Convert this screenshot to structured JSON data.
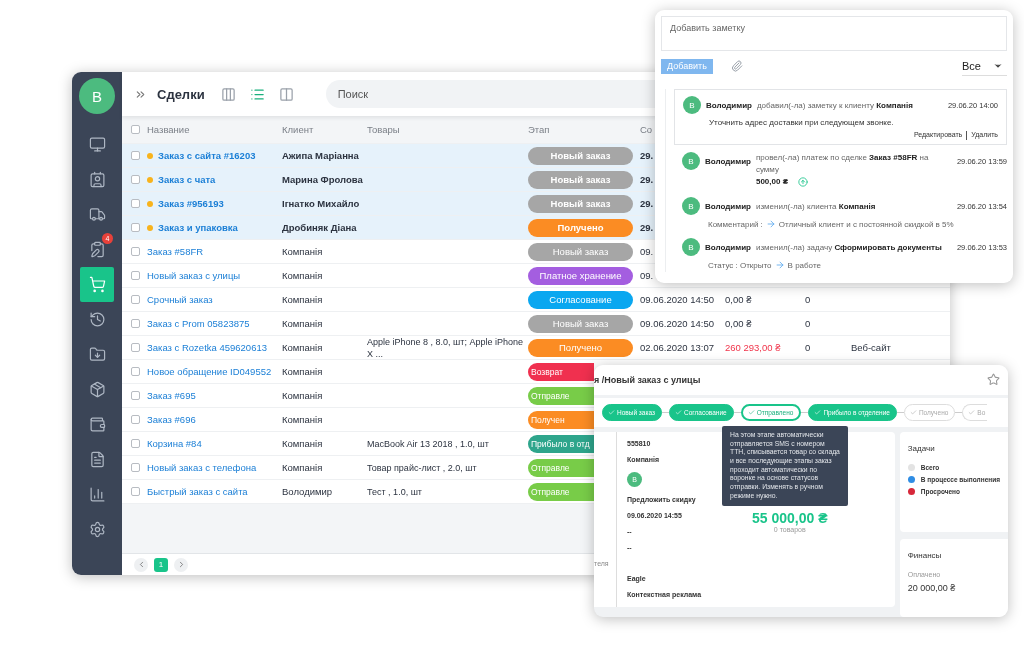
{
  "sidebar": {
    "avatar": "В",
    "items": [
      {
        "selected": false
      },
      {
        "selected": false
      },
      {
        "selected": false
      },
      {
        "selected": false,
        "badge": "4"
      },
      {
        "selected": true
      },
      {
        "selected": false
      },
      {
        "selected": false
      },
      {
        "selected": false
      },
      {
        "selected": false
      },
      {
        "selected": false
      },
      {
        "selected": false
      },
      {
        "selected": false
      }
    ]
  },
  "toolbar": {
    "title": "Сделки",
    "views": [
      {
        "selected": false
      },
      {
        "selected": true
      },
      {
        "selected": false
      }
    ],
    "search": {
      "placeholder": "Поиск"
    }
  },
  "table": {
    "select_all": {
      "checked": false
    },
    "columns": [
      "Название",
      "Клиент",
      "Товары",
      "Этап",
      "Со"
    ],
    "rows": [
      {
        "unread": true,
        "name": "Заказ с сайта #16203",
        "client": "Ажипа Маріанна",
        "stage": "Новый заказ",
        "color": "#a6a6a6",
        "date": "29."
      },
      {
        "unread": true,
        "name": "Заказ с чата",
        "client": "Марина Фролова",
        "stage": "Новый заказ",
        "color": "#a6a6a6",
        "date": "29."
      },
      {
        "unread": true,
        "name": "Заказ #956193",
        "client": "Ігнатко Михайло",
        "stage": "Новый заказ",
        "color": "#a6a6a6",
        "date": "29."
      },
      {
        "unread": true,
        "name": "Заказ и упаковка",
        "client": "Дробиняк Діана",
        "stage": "Получено",
        "color": "#fb8c23",
        "date": "29."
      },
      {
        "unread": false,
        "name": "Заказ #58FR",
        "client": "Компанія",
        "stage": "Новый заказ",
        "color": "#a6a6a6",
        "date": "09."
      },
      {
        "unread": false,
        "name": "Новый заказ с улицы",
        "client": "Компанія",
        "stage": "Платное хранение",
        "color": "#a45ee0",
        "date": "09."
      },
      {
        "unread": false,
        "name": "Срочный заказ",
        "client": "Компанія",
        "stage": "Согласование",
        "color": "#0aa7f0",
        "date": "09.06.2020 14:50",
        "amount": "0,00 ₴",
        "count": "0"
      },
      {
        "unread": false,
        "name": "Заказ с Prom 05823875",
        "client": "Компанія",
        "stage": "Новый заказ",
        "color": "#a6a6a6",
        "date": "09.06.2020 14:50",
        "amount": "0,00 ₴",
        "count": "0"
      },
      {
        "unread": false,
        "name": "Заказ с Rozetka 459620613",
        "client": "Компанія",
        "goods": "Apple iPhone 8 , 8.0, шт; Apple iPhone X ...",
        "stage": "Получено",
        "color": "#fb8c23",
        "date": "02.06.2020 13:07",
        "amount": "260 293,00 ₴",
        "overdue": true,
        "count": "0",
        "source": "Веб-сайт"
      },
      {
        "unread": false,
        "name": "Новое обращение ID049552",
        "client": "Компанія",
        "stage": "Возврат",
        "color": "#f0304f",
        "cut": true
      },
      {
        "unread": false,
        "name": "Заказ #695",
        "client": "Компанія",
        "stage": "Отправле",
        "color": "#78cc48",
        "cut": true
      },
      {
        "unread": false,
        "name": "Заказ #696",
        "client": "Компанія",
        "stage": "Получен",
        "color": "#fb8c23",
        "cut": true
      },
      {
        "unread": false,
        "name": "Корзина #84",
        "client": "Компанія",
        "goods": "MacBook Air 13 2018 , 1.0, шт",
        "stage": "Прибыло в отд",
        "color": "#2ea58c",
        "cut": true
      },
      {
        "unread": false,
        "name": "Новый заказ с телефона",
        "client": "Компанія",
        "goods": "Товар прайс-лист , 2.0, шт",
        "stage": "Отправле",
        "color": "#78cc48",
        "cut": true
      },
      {
        "unread": false,
        "name": "Быстрый заказ с сайта",
        "client": "Володимир",
        "goods": "Тест , 1.0, шт",
        "stage": "Отправле",
        "color": "#78cc48",
        "cut": true
      }
    ]
  },
  "pagination": {
    "pages": [
      {
        "label": "1",
        "selected": true
      }
    ]
  },
  "notes": {
    "input": {
      "placeholder": "Добавить заметку"
    },
    "add_button": {
      "label": "Добавить",
      "disabled": true
    },
    "filter": "Все",
    "feed": [
      {
        "kind": "note",
        "avatar": "В",
        "author": "Володимир",
        "action": "добавил(-ла) заметку к клиенту **Компанія**",
        "time": "29.06.20 14:00",
        "text": "Уточнить адрес доставки при следующем звонке.",
        "links": [
          "Редактировать",
          "Удалить"
        ]
      },
      {
        "kind": "payment",
        "avatar": "В",
        "author": "Володимир",
        "action": "провел(-ла) платеж по сделке **Заказ #58FR** на сумму",
        "amount": "500,00 ₴",
        "time": "29.06.20 13:59"
      },
      {
        "kind": "change",
        "avatar": "В",
        "author": "Володимир",
        "action": "изменил(-ла) клиента **Компанія**",
        "time": "29.06.20 13:54",
        "label": "Комментарий :",
        "value": "Отличный клиент и с постоянной скидкой в 5%"
      },
      {
        "kind": "change",
        "avatar": "В",
        "author": "Володимир",
        "action": "изменил(-ла) задачу **Сформировать документы**",
        "time": "29.06.20 13:53",
        "label": "Статус : Открыто",
        "value": "В работе"
      }
    ]
  },
  "deal": {
    "title": "я /Новый заказ с улицы",
    "starred": false,
    "steps": [
      {
        "label": "Новый заказ",
        "done": true,
        "current": false
      },
      {
        "label": "Согласование",
        "done": true,
        "current": false
      },
      {
        "label": "Отправлено",
        "done": false,
        "current": true
      },
      {
        "label": "Прибыло в отделение",
        "done": true,
        "current": false
      },
      {
        "label": "Получено",
        "done": false,
        "current": false
      },
      {
        "label": "Во",
        "done": false,
        "current": false
      }
    ],
    "tooltip": "На этом этапе автоматически отправляется SMS с номером ТТН, списывается товар со склада и все последующие этапы заказ проходит автоматически по воронке на основе статусов отправки. Изменять в ручном режиме нужно.",
    "side_label": "теля",
    "fields": [
      "555810",
      "Компанія"
    ],
    "avatar": "В",
    "fields2": [
      "Предложить скидку",
      "09.06.2020 14:55",
      "--",
      "--"
    ],
    "fields3": [
      "Eagle",
      "Контекстная реклама"
    ],
    "total": "55 000,00 ₴",
    "total_note": "0 товаров",
    "tasks": {
      "title": "Задачи",
      "legend": [
        {
          "label": "Всего",
          "color": "#e3e3e3"
        },
        {
          "label": "В процессе выполнения",
          "color": "#2f8de4"
        },
        {
          "label": "Просрочено",
          "color": "#d7283a"
        }
      ]
    },
    "finance": {
      "title": "Финансы",
      "label": "Оплачено",
      "value": "20 000,00 ₴"
    }
  }
}
